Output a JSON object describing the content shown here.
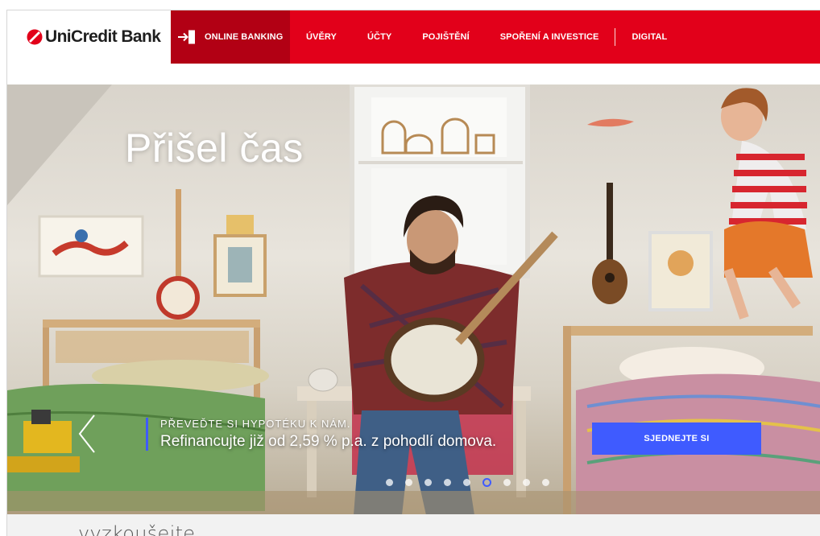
{
  "brand": {
    "name": "UniCredit Bank",
    "color": "#e2001a"
  },
  "nav": {
    "online_banking": "ONLINE BANKING",
    "items": [
      "ÚVĚRY",
      "ÚČTY",
      "POJIŠTĚNÍ",
      "SPOŘENÍ A INVESTICE"
    ],
    "digital": "DIGITAL",
    "login_icon": "login-arrow-icon"
  },
  "hero": {
    "title": "Přišel čas",
    "promo_kicker": "PŘEVEĎTE SI HYPOTÉKU K NÁM.",
    "promo_text": "Refinancujte již od 2,59 % p.a. z pohodlí domova.",
    "cta_label": "SJEDNEJTE SI",
    "slides_count": 9,
    "active_slide": 6,
    "accent_color": "#3f5bff"
  },
  "section": {
    "title": "vyzkoušejte"
  }
}
